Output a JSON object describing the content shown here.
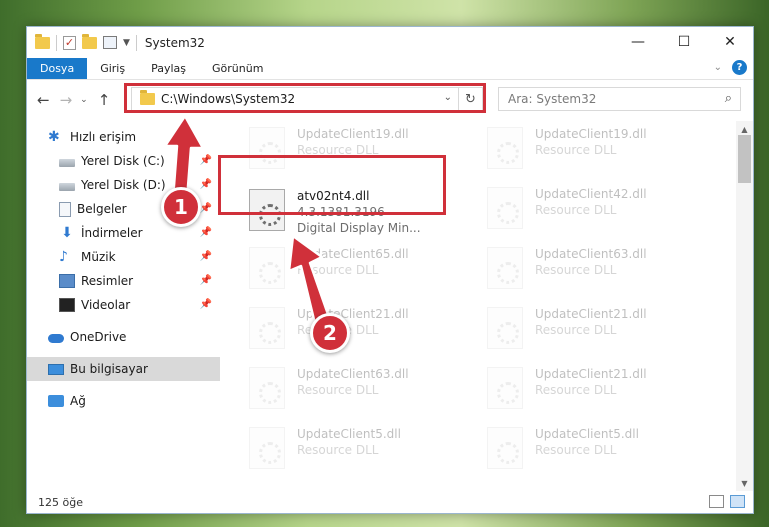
{
  "window": {
    "title": "System32",
    "controls": {
      "minimize": "—",
      "maximize": "☐",
      "close": "✕"
    }
  },
  "ribbon": {
    "tabs": [
      "Dosya",
      "Giriş",
      "Paylaş",
      "Görünüm"
    ],
    "expand": "⌄",
    "help": "?"
  },
  "nav": {
    "back": "←",
    "forward": "→",
    "recent": "⌄",
    "up": "↑",
    "address": "C:\\Windows\\System32",
    "address_dropdown": "⌄",
    "refresh": "↻",
    "search_placeholder": "Ara: System32",
    "search_icon": "⌕"
  },
  "sidebar": {
    "items": [
      {
        "label": "Hızlı erişim",
        "icon": "star-icon",
        "pinned": false
      },
      {
        "label": "Yerel Disk (C:)",
        "icon": "drive-icon",
        "pinned": true
      },
      {
        "label": "Yerel Disk (D:)",
        "icon": "drive-icon",
        "pinned": true
      },
      {
        "label": "Belgeler",
        "icon": "documents-icon",
        "pinned": true
      },
      {
        "label": "İndirmeler",
        "icon": "downloads-icon",
        "pinned": true
      },
      {
        "label": "Müzik",
        "icon": "music-icon",
        "pinned": true
      },
      {
        "label": "Resimler",
        "icon": "pictures-icon",
        "pinned": true
      },
      {
        "label": "Videolar",
        "icon": "videos-icon",
        "pinned": true
      },
      {
        "label": "OneDrive",
        "icon": "onedrive-icon",
        "pinned": false
      },
      {
        "label": "Bu bilgisayar",
        "icon": "this-pc-icon",
        "pinned": false,
        "selected": true
      },
      {
        "label": "Ağ",
        "icon": "network-icon",
        "pinned": false
      }
    ],
    "pin_glyph": "📌"
  },
  "files": {
    "col1": [
      {
        "name": "UpdateClient19.dll",
        "type": "Resource DLL"
      },
      {
        "name": "atv02nt4.dll",
        "version": "4.3.1381.3196",
        "description": "Digital Display Min...",
        "focused": true
      },
      {
        "name": "UpdateClient65.dll",
        "type": "Resource DLL"
      },
      {
        "name": "UpdateClient21.dll",
        "type": "Resource DLL"
      },
      {
        "name": "UpdateClient63.dll",
        "type": "Resource DLL"
      },
      {
        "name": "UpdateClient5.dll",
        "type": "Resource DLL"
      }
    ],
    "col2": [
      {
        "name": "UpdateClient19.dll",
        "type": "Resource DLL"
      },
      {
        "name": "UpdateClient42.dll",
        "type": "Resource DLL"
      },
      {
        "name": "UpdateClient63.dll",
        "type": "Resource DLL"
      },
      {
        "name": "UpdateClient21.dll",
        "type": "Resource DLL"
      },
      {
        "name": "UpdateClient21.dll",
        "type": "Resource DLL"
      },
      {
        "name": "UpdateClient5.dll",
        "type": "Resource DLL"
      }
    ]
  },
  "status": {
    "count": "125 öğe"
  },
  "callouts": {
    "step1": "1",
    "step2": "2"
  },
  "colors": {
    "accent": "#1979ca",
    "highlight": "#d0303a"
  }
}
